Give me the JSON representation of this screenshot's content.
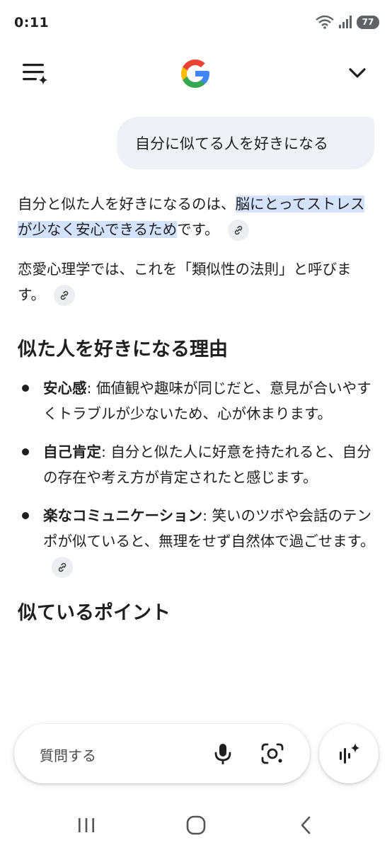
{
  "status_bar": {
    "time": "0:11",
    "battery": "77"
  },
  "conversation": {
    "user_query": "自分に似てる人を好きになる",
    "answer": {
      "p1_before": "自分と似た人を好きになるのは、",
      "p1_highlight": "脳にとってストレスが少なく安心できるため",
      "p1_after": "です。",
      "p2": "恋愛心理学では、これを「類似性の法則」と呼びます。",
      "section1_title": "似た人を好きになる理由",
      "reasons": [
        {
          "term": "安心感",
          "text": ": 価値観や趣味が同じだと、意見が合いやすくトラブルが少ないため、心が休まります。"
        },
        {
          "term": "自己肯定",
          "text": ": 自分と似た人に好意を持たれると、自分の存在や考え方が肯定されたと感じます。"
        },
        {
          "term": "楽なコミュニケーション",
          "text": ": 笑いのツボや会話のテンポが似ていると、無理をせず自然体で過ごせます。"
        }
      ],
      "section2_title": "似ているポイント"
    }
  },
  "input_bar": {
    "placeholder": "質問する"
  },
  "icons": {
    "menu": "menu-sparkle-icon",
    "logo": "google-g-logo",
    "chevron": "chevron-down-icon",
    "link": "link-icon",
    "mic": "mic-icon",
    "lens": "lens-icon",
    "live": "live-sparkle-icon"
  },
  "colors": {
    "highlight": "#d3e3fd",
    "bubble": "#eef1f6",
    "google_blue": "#4285F4",
    "google_red": "#EA4335",
    "google_yellow": "#FBBC05",
    "google_green": "#34A853"
  }
}
